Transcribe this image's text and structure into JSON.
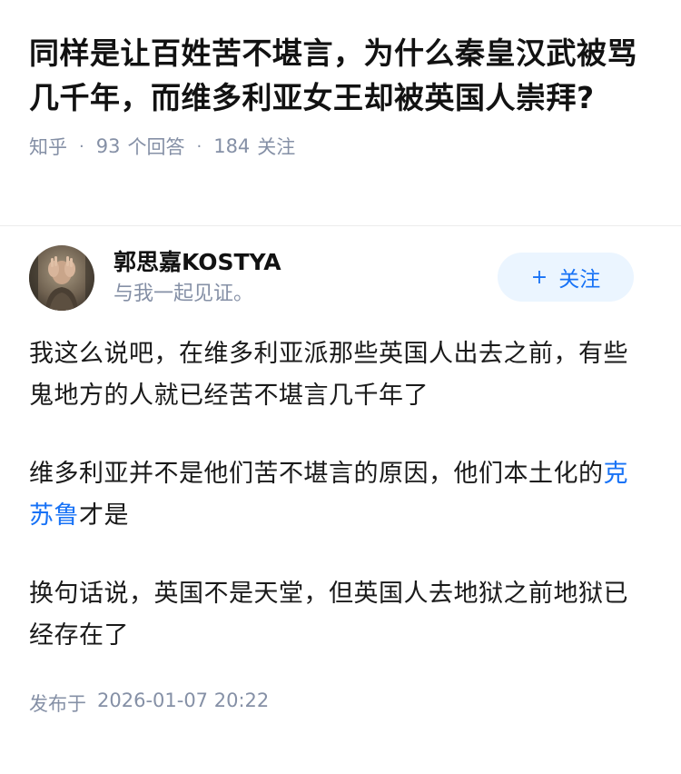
{
  "question": {
    "title": "同样是让百姓苦不堪言，为什么秦皇汉武被骂几千年，而维多利亚女王却被英国人崇拜?",
    "source": "知乎",
    "separator": "·",
    "answers_count": "93",
    "answers_label": "个回答",
    "followers_count": "184",
    "followers_label": "关注"
  },
  "author": {
    "name": "郭思嘉KOSTYA",
    "bio": "与我一起见证。",
    "avatar_icon": "avatar-photo",
    "follow_button": {
      "plus": "+",
      "label": "关注"
    }
  },
  "content": {
    "paragraphs": [
      {
        "text": "我这么说吧，在维多利亚派那些英国人出去之前，有些鬼地方的人就已经苦不堪言几千年了"
      },
      {
        "before": "维多利亚并不是他们苦不堪言的原因，他们本土化的",
        "link": "克苏鲁",
        "after": "才是"
      },
      {
        "text": "换句话说，英国不是天堂，但英国人去地狱之前地狱已经存在了"
      }
    ]
  },
  "footer": {
    "publish_label": "发布于",
    "publish_time": "2026-01-07 20:22"
  },
  "colors": {
    "meta_gray": "#8590a6",
    "link_blue": "#1772f6",
    "follow_bg": "#ebf5ff"
  }
}
